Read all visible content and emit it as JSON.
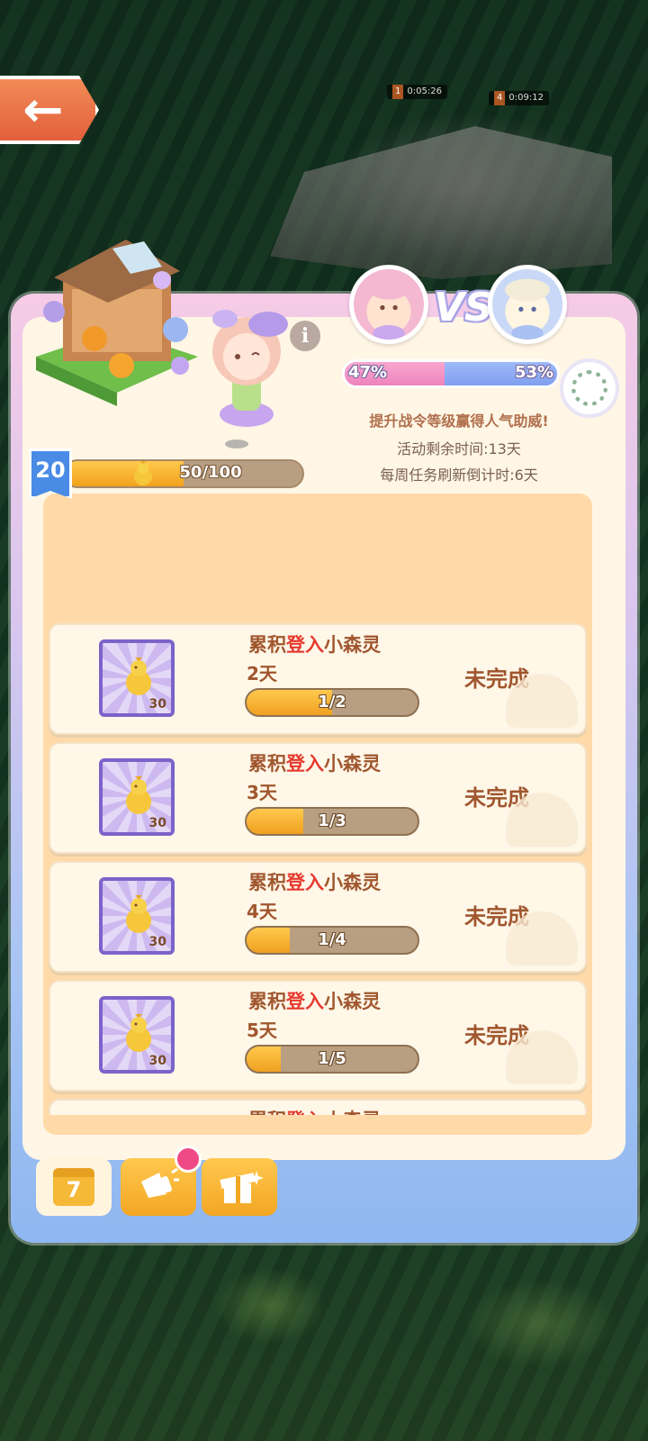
{
  "hud": {
    "timer1_num": "1",
    "timer1_time": "0:05:26",
    "timer2_num": "4",
    "timer2_time": "0:09:12"
  },
  "versus": {
    "vs_text": "VS",
    "left_pct_label": "47%",
    "right_pct_label": "53%",
    "left_share": 47,
    "right_share": 53
  },
  "info": {
    "promo": "提升战令等级赢得人气助威!",
    "remaining": "活动剩余时间:13天",
    "weekly_refresh": "每周任务刷新倒计时:6天"
  },
  "level": {
    "number": "20",
    "progress_text": "50/100",
    "progress_fraction": 0.5
  },
  "tasks": [
    {
      "title_a": "累积",
      "title_b": "登入",
      "title_c": "小森灵",
      "days": "2天",
      "progress_text": "1/2",
      "progress_fraction": 0.5,
      "reward_qty": "30",
      "status": "未完成"
    },
    {
      "title_a": "累积",
      "title_b": "登入",
      "title_c": "小森灵",
      "days": "3天",
      "progress_text": "1/3",
      "progress_fraction": 0.333,
      "reward_qty": "30",
      "status": "未完成"
    },
    {
      "title_a": "累积",
      "title_b": "登入",
      "title_c": "小森灵",
      "days": "4天",
      "progress_text": "1/4",
      "progress_fraction": 0.25,
      "reward_qty": "30",
      "status": "未完成"
    },
    {
      "title_a": "累积",
      "title_b": "登入",
      "title_c": "小森灵",
      "days": "5天",
      "progress_text": "1/5",
      "progress_fraction": 0.2,
      "reward_qty": "30",
      "status": "未完成"
    },
    {
      "title_a": "累积",
      "title_b": "登入",
      "title_c": "小森灵",
      "days": "",
      "progress_text": "",
      "progress_fraction": 0,
      "reward_qty": "",
      "status": ""
    }
  ],
  "tabs": {
    "calendar_number": "7",
    "tab1_icon": "calendar-icon",
    "tab2_icon": "cheer-horn-icon",
    "tab3_icon": "gift-icon"
  },
  "colors": {
    "left_team": "#ee84bd",
    "right_team": "#7f9ff0",
    "accent_gold": "#f2a21b",
    "task_text": "#a0562e",
    "highlight_red": "#e63a2e"
  }
}
